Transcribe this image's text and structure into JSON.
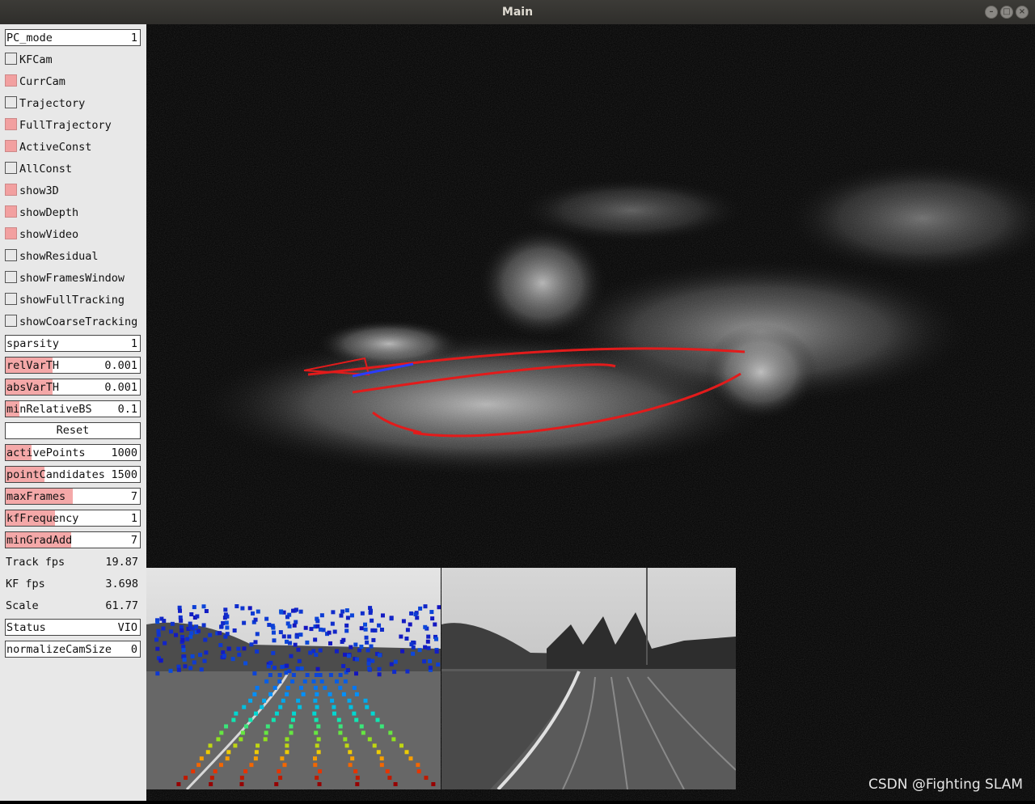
{
  "window": {
    "title": "Main"
  },
  "panel": {
    "pc_mode": {
      "label": "PC_mode",
      "value": "1"
    },
    "checkboxes": [
      {
        "label": "KFCam",
        "checked": false
      },
      {
        "label": "CurrCam",
        "checked": true
      },
      {
        "label": "Trajectory",
        "checked": false
      },
      {
        "label": "FullTrajectory",
        "checked": true
      },
      {
        "label": "ActiveConst",
        "checked": true
      },
      {
        "label": "AllConst",
        "checked": false
      },
      {
        "label": "show3D",
        "checked": true
      },
      {
        "label": "showDepth",
        "checked": true
      },
      {
        "label": "showVideo",
        "checked": true
      },
      {
        "label": "showResidual",
        "checked": false
      },
      {
        "label": "showFramesWindow",
        "checked": false
      },
      {
        "label": "showFullTracking",
        "checked": false
      },
      {
        "label": "showCoarseTracking",
        "checked": false
      }
    ],
    "sparsity": {
      "label": "sparsity",
      "value": "1"
    },
    "relVarTH": {
      "label": "relVarTH",
      "value": "0.001",
      "level": 0.35
    },
    "absVarTH": {
      "label": "absVarTH",
      "value": "0.001",
      "level": 0.35
    },
    "minRelativeBS": {
      "label": "minRelativeBS",
      "value": "0.1",
      "level": 0.1
    },
    "reset": {
      "label": "Reset"
    },
    "activePoints": {
      "label": "activePoints",
      "value": "1000",
      "level": 0.19
    },
    "pointCandidates": {
      "label": "pointCandidates",
      "value": "1500",
      "level": 0.29
    },
    "maxFrames": {
      "label": "maxFrames",
      "value": "7",
      "level": 0.5
    },
    "kfFrequency": {
      "label": "kfFrequency",
      "value": "1",
      "level": 0.37
    },
    "minGradAdd": {
      "label": "minGradAdd",
      "value": "7",
      "level": 0.49
    },
    "track_fps": {
      "label": "Track fps",
      "value": "19.87"
    },
    "kf_fps": {
      "label": "KF fps",
      "value": "3.698"
    },
    "scale": {
      "label": "Scale",
      "value": "61.77"
    },
    "status": {
      "label": "Status",
      "value": "VIO"
    },
    "normalizeCamSize": {
      "label": "normalizeCamSize",
      "value": "0"
    }
  },
  "colors": {
    "panel_bg": "#e8e8e8",
    "slider_fill": "#f4a8a8",
    "trajectory": "#e21b1b",
    "current_cam": "#2a3cff"
  },
  "watermark": "CSDN @Fighting SLAM"
}
